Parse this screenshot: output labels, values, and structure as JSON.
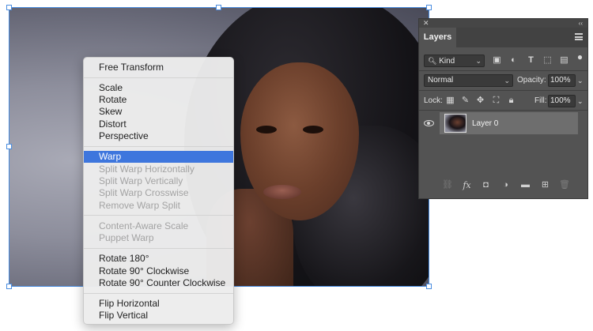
{
  "menu": {
    "items": [
      {
        "label": "Free Transform",
        "state": "normal"
      },
      {
        "label": "Scale",
        "state": "normal"
      },
      {
        "label": "Rotate",
        "state": "normal"
      },
      {
        "label": "Skew",
        "state": "normal"
      },
      {
        "label": "Distort",
        "state": "normal"
      },
      {
        "label": "Perspective",
        "state": "normal"
      },
      {
        "label": "Warp",
        "state": "highlighted"
      },
      {
        "label": "Split Warp Horizontally",
        "state": "disabled"
      },
      {
        "label": "Split Warp Vertically",
        "state": "disabled"
      },
      {
        "label": "Split Warp Crosswise",
        "state": "disabled"
      },
      {
        "label": "Remove Warp Split",
        "state": "disabled"
      },
      {
        "label": "Content-Aware Scale",
        "state": "disabled"
      },
      {
        "label": "Puppet Warp",
        "state": "disabled"
      },
      {
        "label": "Rotate 180°",
        "state": "normal"
      },
      {
        "label": "Rotate 90° Clockwise",
        "state": "normal"
      },
      {
        "label": "Rotate 90° Counter Clockwise",
        "state": "normal"
      },
      {
        "label": "Flip Horizontal",
        "state": "normal"
      },
      {
        "label": "Flip Vertical",
        "state": "normal"
      }
    ]
  },
  "layers_panel": {
    "close_glyph": "✕",
    "collapse_glyph": "‹‹",
    "tab_label": "Layers",
    "filter": {
      "label": "Kind",
      "icon": "search-icon"
    },
    "blend_mode": "Normal",
    "opacity_label": "Opacity:",
    "opacity_value": "100%",
    "lock_label": "Lock:",
    "fill_label": "Fill:",
    "fill_value": "100%",
    "layer": {
      "name": "Layer 0",
      "visible": true
    }
  },
  "colors": {
    "highlight": "#3e76dd",
    "panel_bg": "#535353",
    "selection_border": "#4a8de0"
  }
}
